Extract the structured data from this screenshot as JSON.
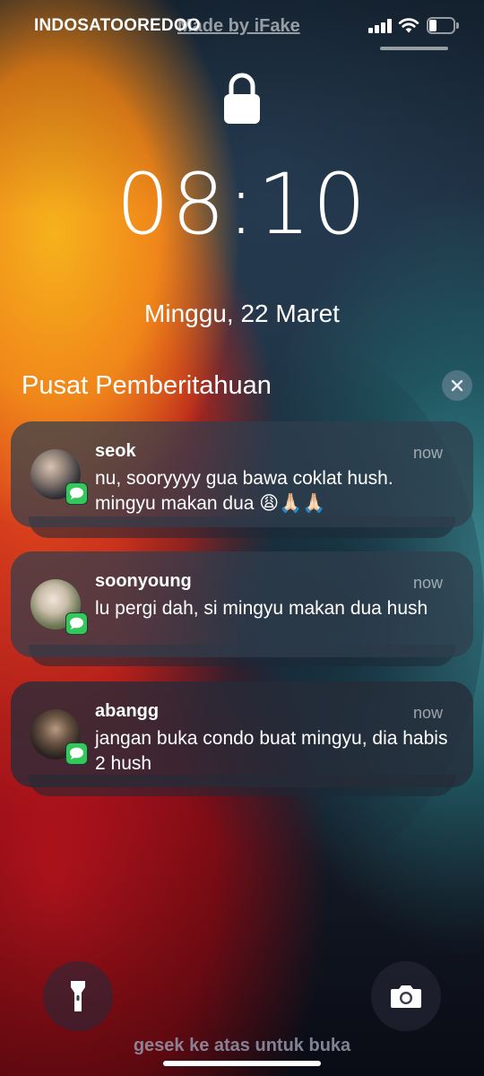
{
  "status_bar": {
    "carrier": "INDOSATOOREDOO",
    "watermark": "Made by iFake",
    "signal_bars": 4,
    "battery_level": 0.3
  },
  "lock": {
    "icon": "lock-icon",
    "time": "08:10",
    "date": "Minggu, 22 Maret"
  },
  "notification_center": {
    "title": "Pusat Pemberitahuan",
    "clear_icon": "close-icon"
  },
  "notifications": [
    {
      "sender": "seok",
      "time": "now",
      "message": "nu, sooryyyy gua bawa coklat hush. mingyu makan dua 😩🙏🏻🙏🏻",
      "app_icon": "messages-icon"
    },
    {
      "sender": "soonyoung",
      "time": "now",
      "message": "lu pergi dah, si mingyu makan dua hush",
      "app_icon": "messages-icon"
    },
    {
      "sender": "abangg",
      "time": "now",
      "message": "jangan buka condo buat mingyu, dia habis 2 hush",
      "app_icon": "messages-icon"
    }
  ],
  "bottom": {
    "flashlight_icon": "flashlight-icon",
    "camera_icon": "camera-icon",
    "swipe_hint": "gesek ke atas untuk buka"
  },
  "colors": {
    "messages_green": "#34c759"
  }
}
